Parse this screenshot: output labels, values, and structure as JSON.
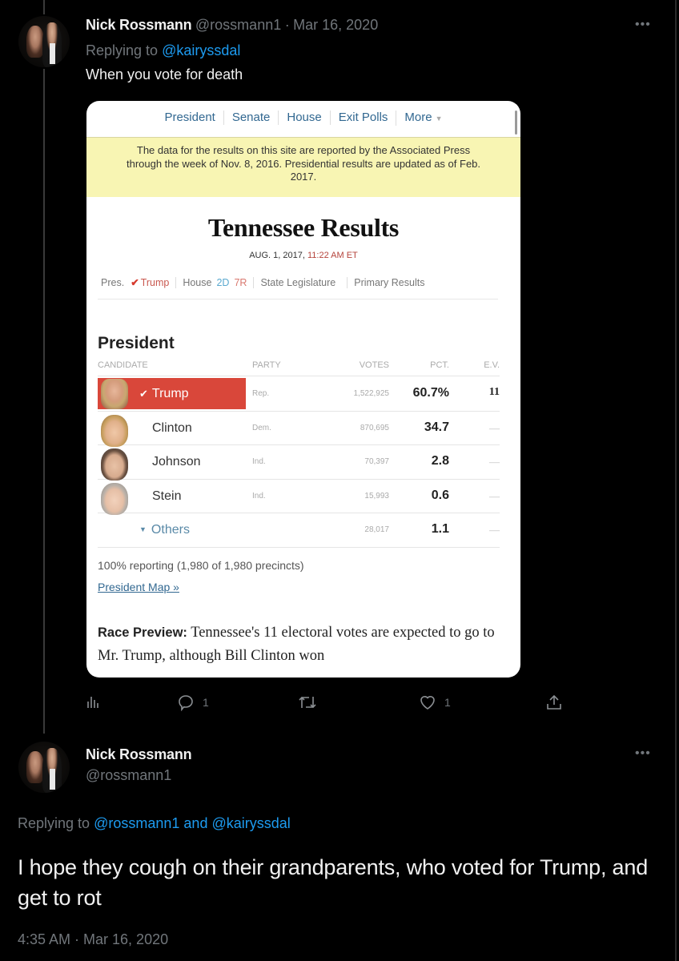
{
  "tweet1": {
    "author_name": "Nick Rossmann",
    "handle": "@rossmann1",
    "separator": "·",
    "date": "Mar 16, 2020",
    "replying_prefix": "Replying to",
    "replying_to": "@kairyssdal",
    "text": "When you vote for death",
    "more_icon": "more-horizontal-icon",
    "actions": {
      "analytics_icon": "analytics-icon",
      "reply_icon": "reply-icon",
      "reply_count": "1",
      "retweet_icon": "retweet-icon",
      "like_icon": "heart-icon",
      "like_count": "1",
      "share_icon": "share-icon"
    },
    "embedded_screenshot": {
      "top_nav": [
        "President",
        "Senate",
        "House",
        "Exit Polls",
        "More"
      ],
      "notice": "The data for the results on this site are reported by the Associated Press through the week of Nov. 8, 2016. Presidential results are updated as of Feb. 2017.",
      "title": "Tennessee Results",
      "date": "AUG. 1, 2017,",
      "time": "11:22 AM ET",
      "subnav": {
        "pres_label": "Pres.",
        "pres_winner": "Trump",
        "house_label": "House",
        "house_d": "2D",
        "house_r": "7R",
        "state_legislature": "State Legislature",
        "primary_results": "Primary Results"
      },
      "section_title": "President",
      "table": {
        "headers": [
          "CANDIDATE",
          "PARTY",
          "VOTES",
          "PCT.",
          "E.V."
        ],
        "rows": [
          {
            "candidate": "Trump",
            "party": "Rep.",
            "votes": "1,522,925",
            "pct": "60.7%",
            "ev": "11",
            "winner": true
          },
          {
            "candidate": "Clinton",
            "party": "Dem.",
            "votes": "870,695",
            "pct": "34.7",
            "ev": "—"
          },
          {
            "candidate": "Johnson",
            "party": "Ind.",
            "votes": "70,397",
            "pct": "2.8",
            "ev": "—"
          },
          {
            "candidate": "Stein",
            "party": "Ind.",
            "votes": "15,993",
            "pct": "0.6",
            "ev": "—"
          },
          {
            "candidate": "Others",
            "party": "",
            "votes": "28,017",
            "pct": "1.1",
            "ev": "—"
          }
        ]
      },
      "reporting": "100% reporting (1,980 of 1,980 precincts)",
      "map_link": "President Map »",
      "preview_label": "Race Preview:",
      "preview_text": " Tennessee's 11 electoral votes are expected to go to Mr. Trump, although Bill Clinton won",
      "colors": {
        "winner_red": "#d9473a",
        "notice_yellow": "#f8f5b3",
        "link_blue": "#326891"
      }
    }
  },
  "tweet2": {
    "author_name": "Nick Rossmann",
    "handle": "@rossmann1",
    "replying_prefix": "Replying to",
    "replying_to_1": "@rossmann1",
    "replying_and": "and",
    "replying_to_2": "@kairyssdal",
    "text": "I hope they cough on their grandparents, who voted for Trump, and get to rot",
    "timestamp": "4:35 AM · Mar 16, 2020",
    "more_icon": "more-horizontal-icon"
  },
  "colors": {
    "background": "#000000",
    "link": "#1d9bf0",
    "secondary_text": "#71767b"
  }
}
